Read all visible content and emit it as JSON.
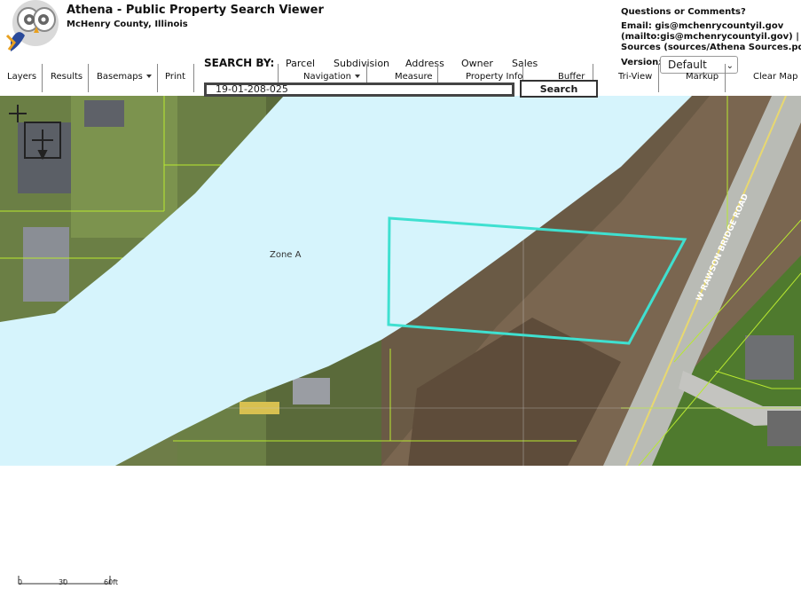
{
  "header": {
    "title": "Athena - Public Property Search Viewer",
    "subtitle": "McHenry County, Illinois",
    "contact": {
      "heading": "Questions or Comments?",
      "email_line": "Email: gis@mchenrycountyil.gov",
      "mailto_line": "(mailto:gis@mchenrycountyil.gov)  |",
      "sources_line": "Sources (sources/Athena Sources.pdf)"
    },
    "version": {
      "label": "Version:",
      "selected": "Default"
    }
  },
  "search": {
    "label": "SEARCH BY:",
    "options": [
      "Parcel",
      "Subdivision",
      "Address",
      "Owner",
      "Sales"
    ],
    "value": "19-01-208-025",
    "button": "Search"
  },
  "toolbar": {
    "layers": "Layers",
    "results": "Results",
    "basemaps": "Basemaps",
    "print": "Print",
    "navigation": "Navigation",
    "measure": "Measure",
    "property_info": "Property Info",
    "buffer": "Buffer",
    "tri_view": "Tri-View",
    "markup": "Markup",
    "clear_map": "Clear Map"
  },
  "map": {
    "zone_label": "Zone A",
    "road_label": "W RAWSON BRIDGE ROAD",
    "colors": {
      "flood_zone": "#d6f4fc",
      "parcel_highlight": "#3fe0d0",
      "parcel_lines": "#b8e830"
    }
  },
  "scale_bar": {
    "ticks": [
      "0",
      "30",
      "60ft"
    ]
  }
}
